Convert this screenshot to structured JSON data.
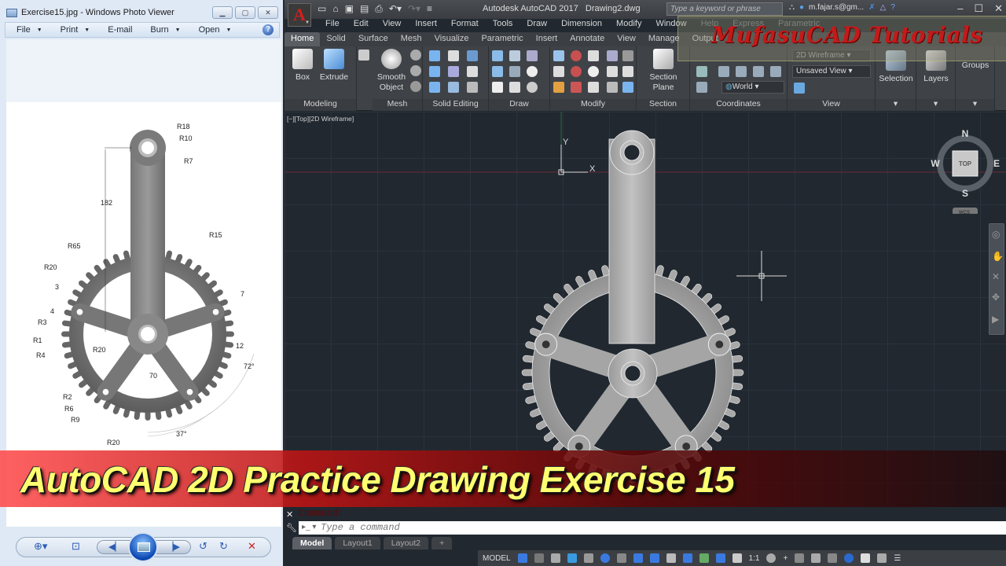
{
  "photo_viewer": {
    "title": "Exercise15.jpg - Windows Photo Viewer",
    "window_controls": [
      "minimize",
      "maximize",
      "close"
    ],
    "menu": [
      {
        "label": "File",
        "has_dropdown": true
      },
      {
        "label": "Print",
        "has_dropdown": true
      },
      {
        "label": "E-mail",
        "has_dropdown": false
      },
      {
        "label": "Burn",
        "has_dropdown": true
      },
      {
        "label": "Open",
        "has_dropdown": true
      }
    ],
    "help_icon": "?",
    "drawing_dimensions": {
      "top_radii": [
        "R18",
        "R10",
        "R7"
      ],
      "arm_length": "182",
      "R65": "R65",
      "R15": "R15",
      "R20_upper": "R20",
      "tooth_3": "3",
      "tooth_4": "4",
      "R3": "R3",
      "R1": "R1",
      "R4": "R4",
      "R20_center": "R20",
      "R2": "R2",
      "R6": "R6",
      "R9": "R9",
      "R20_bottom": "R20",
      "seven": "7",
      "twelve": "12",
      "angle_72": "72°",
      "seventy": "70",
      "angle_37": "37°"
    },
    "toolbar": [
      "zoom",
      "fit",
      "previous",
      "slideshow",
      "next",
      "rotate-ccw",
      "rotate-cw",
      "delete"
    ]
  },
  "autocad": {
    "app_title": "Autodesk AutoCAD 2017",
    "file_name": "Drawing2.dwg",
    "search_placeholder": "Type a keyword or phrase",
    "user": "m.fajar.s@gm...",
    "logo_letter": "A",
    "menubar": [
      "File",
      "Edit",
      "View",
      "Insert",
      "Format",
      "Tools",
      "Draw",
      "Dimension",
      "Modify",
      "Window",
      "Help",
      "Express",
      "Parametric"
    ],
    "ribbon_tabs": [
      "Home",
      "Solid",
      "Surface",
      "Mesh",
      "Visualize",
      "Parametric",
      "Insert",
      "Annotate",
      "View",
      "Manage",
      "Output"
    ],
    "active_tab": "Home",
    "panels": {
      "modeling": {
        "title": "Modeling",
        "box": "Box",
        "extrude": "Extrude"
      },
      "mesh": {
        "title": "Mesh",
        "smooth_line1": "Smooth",
        "smooth_line2": "Object"
      },
      "solid_editing": {
        "title": "Solid Editing"
      },
      "draw": {
        "title": "Draw"
      },
      "modify": {
        "title": "Modify"
      },
      "section": {
        "title": "Section",
        "plane_line1": "Section",
        "plane_line2": "Plane"
      },
      "coordinates": {
        "title": "Coordinates",
        "ucs": "World"
      },
      "view": {
        "title": "View",
        "visual_style": "2D Wireframe",
        "named_view": "Unsaved View"
      },
      "selection": {
        "title": "Selection"
      },
      "layers": {
        "title": "Layers"
      },
      "groups": {
        "title": "Groups"
      }
    },
    "viewport_label": "[−][Top][2D Wireframe]",
    "ucs": {
      "x": "X",
      "y": "Y"
    },
    "viewcube": {
      "n": "N",
      "s": "S",
      "e": "E",
      "w": "W",
      "face": "TOP",
      "wcs": "WCS"
    },
    "command_history": "Command:",
    "command_placeholder": "Type a command",
    "layout_tabs": [
      "Model",
      "Layout1",
      "Layout2"
    ],
    "active_layout": "Model",
    "status": {
      "mode": "MODEL",
      "scale": "1:1"
    }
  },
  "overlay": {
    "watermark": "MufasuCAD Tutorials",
    "banner": "AutoCAD 2D Practice Drawing Exercise 15"
  },
  "colors": {
    "banner_text": "#ffff70",
    "watermark_red": "#c41a1a",
    "viewport_bg": "#212830",
    "acad_logo_red": "#d51e1e"
  }
}
